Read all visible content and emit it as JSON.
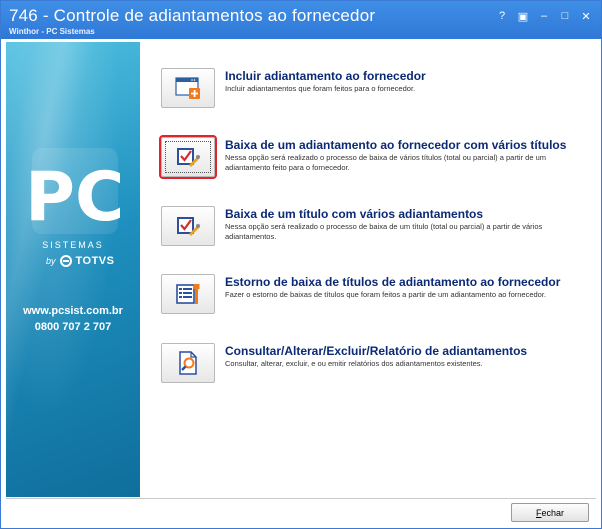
{
  "window": {
    "title": "746 - Controle de adiantamentos ao fornecedor",
    "subtitle": "Winthor - PC Sistemas",
    "controls": [
      "?",
      "▣",
      "–",
      "□",
      "✕"
    ]
  },
  "brand": {
    "logo_text": "PC",
    "sistemas": "SISTEMAS",
    "by": "by",
    "totvs": "TOTVS",
    "url": "www.pcsist.com.br",
    "phone": "0800 707 2 707",
    "accent": "#1e8fbe"
  },
  "options": [
    {
      "title": "Incluir adiantamento ao fornecedor",
      "desc": "Incluir adiantamentos que foram feitos para o fornecedor.",
      "icon": "window-add-icon",
      "selected": false
    },
    {
      "title": "Baixa de um adiantamento ao fornecedor com vários títulos",
      "desc": "Nessa opção será realizado o processo de baixa de vários títulos (total ou parcial) a partir de um adiantamento feito para o fornecedor.",
      "icon": "checkbox-edit-icon",
      "selected": true
    },
    {
      "title": "Baixa de um título com vários adiantamentos",
      "desc": "Nessa opção será realizado o processo de baixa de um título (total ou parcial) a partir de vários adiantamentos.",
      "icon": "checkbox-edit-icon",
      "selected": false
    },
    {
      "title": "Estorno de baixa de títulos de adiantamento ao fornecedor",
      "desc": "Fazer o estorno de baixas de títulos que foram feitos a partir de um adiantamento ao fornecedor.",
      "icon": "list-wrench-icon",
      "selected": false
    },
    {
      "title": "Consultar/Alterar/Excluir/Relatório de adiantamentos",
      "desc": "Consultar, alterar, excluir, e ou emitir relatórios dos adiantamentos existentes.",
      "icon": "document-search-icon",
      "selected": false
    }
  ],
  "footer": {
    "close_first": "F",
    "close_rest": "echar"
  },
  "colors": {
    "titlebar": "#2f78d6",
    "option_title": "#0b2a75",
    "selection_outline": "#e0242d"
  }
}
